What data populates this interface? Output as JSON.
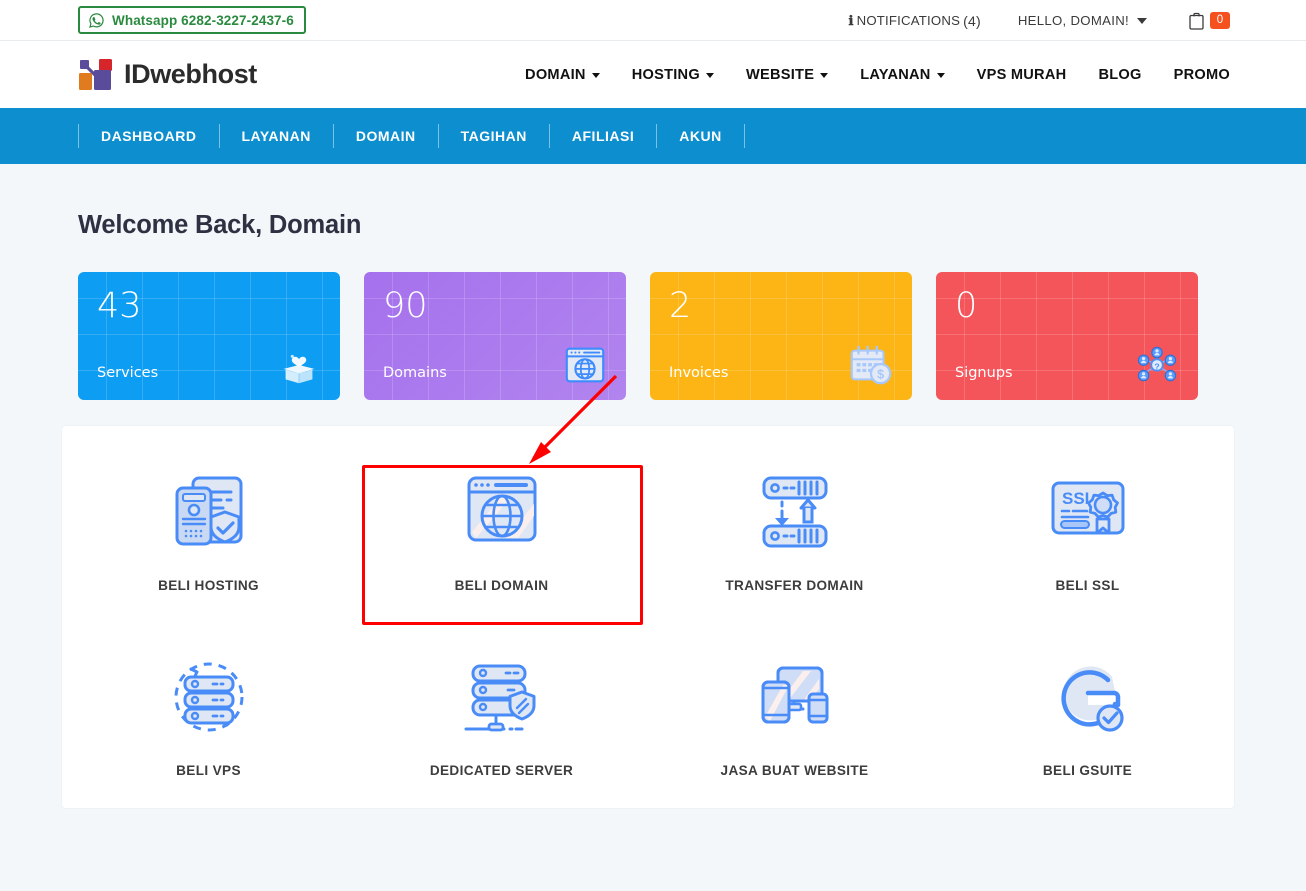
{
  "topbar": {
    "whatsapp": {
      "icon": "whatsapp-icon",
      "label": "Whatsapp",
      "number": "6282-3227-2437-6",
      "border_color": "#2a8a3f"
    },
    "notifications": {
      "icon": "info-icon",
      "label": "NOTIFICATIONS",
      "count": "(4)"
    },
    "account": {
      "label": "HELLO, DOMAIN!",
      "icon": "chevron-down-icon"
    },
    "cart": {
      "icon": "cart-icon",
      "count": "0",
      "badge_color": "#f4511e"
    }
  },
  "header": {
    "logo": {
      "text": "IDwebhost",
      "colors": [
        "#e07b1f",
        "#5b4b9b",
        "#d6262c"
      ]
    },
    "nav": [
      {
        "label": "DOMAIN",
        "has_caret": true
      },
      {
        "label": "HOSTING",
        "has_caret": true
      },
      {
        "label": "WEBSITE",
        "has_caret": true
      },
      {
        "label": "LAYANAN",
        "has_caret": true
      },
      {
        "label": "VPS MURAH",
        "has_caret": false
      },
      {
        "label": "BLOG",
        "has_caret": false
      },
      {
        "label": "PROMO",
        "has_caret": false
      }
    ]
  },
  "bluenav": {
    "background": "#0d8ecf",
    "items": [
      {
        "label": "DASHBOARD"
      },
      {
        "label": "LAYANAN"
      },
      {
        "label": "DOMAIN"
      },
      {
        "label": "TAGIHAN"
      },
      {
        "label": "AFILIASI"
      },
      {
        "label": "AKUN"
      }
    ]
  },
  "main": {
    "welcome_title": "Welcome Back, Domain",
    "stats": [
      {
        "value": "43",
        "label": "Services",
        "color": "#0d9df2",
        "icon": "gift-box-heart-icon"
      },
      {
        "value": "90",
        "label": "Domains",
        "color": "#a571ed",
        "icon": "browser-globe-icon",
        "highlighted": true
      },
      {
        "value": "2",
        "label": "Invoices",
        "color": "#fcb514",
        "icon": "calendar-money-icon"
      },
      {
        "value": "0",
        "label": "Signups",
        "color": "#f4555a",
        "icon": "users-network-icon"
      }
    ],
    "annotation": {
      "type": "red-arrow-and-box",
      "color": "#fe0000",
      "points_to": "Domains"
    },
    "services": [
      {
        "label": "BELI HOSTING",
        "icon": "hosting-server-shield-icon"
      },
      {
        "label": "BELI DOMAIN",
        "icon": "browser-globe-icon"
      },
      {
        "label": "TRANSFER DOMAIN",
        "icon": "server-transfer-arrows-icon"
      },
      {
        "label": "BELI SSL",
        "icon": "ssl-certificate-icon"
      },
      {
        "label": "BELI VPS",
        "icon": "vps-server-refresh-icon"
      },
      {
        "label": "DEDICATED SERVER",
        "icon": "dedicated-server-shield-icon"
      },
      {
        "label": "JASA BUAT WEBSITE",
        "icon": "responsive-devices-icon"
      },
      {
        "label": "BELI GSUITE",
        "icon": "gsuite-g-check-icon"
      }
    ]
  }
}
